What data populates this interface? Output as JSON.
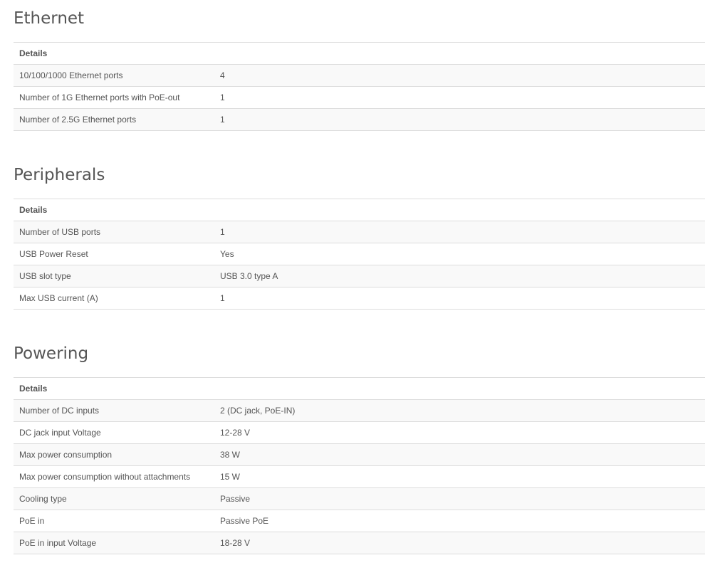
{
  "sections": [
    {
      "title": "Ethernet",
      "header": "Details",
      "rows": [
        {
          "label": "10/100/1000 Ethernet ports",
          "value": "4"
        },
        {
          "label": "Number of 1G Ethernet ports with PoE-out",
          "value": "1"
        },
        {
          "label": "Number of 2.5G Ethernet ports",
          "value": "1"
        }
      ]
    },
    {
      "title": "Peripherals",
      "header": "Details",
      "rows": [
        {
          "label": "Number of USB ports",
          "value": "1"
        },
        {
          "label": "USB Power Reset",
          "value": "Yes"
        },
        {
          "label": "USB slot type",
          "value": "USB 3.0 type A"
        },
        {
          "label": "Max USB current (A)",
          "value": "1"
        }
      ]
    },
    {
      "title": "Powering",
      "header": "Details",
      "rows": [
        {
          "label": "Number of DC inputs",
          "value": "2 (DC jack, PoE-IN)"
        },
        {
          "label": "DC jack input Voltage",
          "value": "12-28 V"
        },
        {
          "label": "Max power consumption",
          "value": "38 W"
        },
        {
          "label": "Max power consumption without attachments",
          "value": "15 W"
        },
        {
          "label": "Cooling type",
          "value": "Passive"
        },
        {
          "label": "PoE in",
          "value": "Passive PoE"
        },
        {
          "label": "PoE in input Voltage",
          "value": "18-28 V"
        }
      ]
    }
  ],
  "colors": {
    "text": "#555555",
    "border": "#dddddd",
    "row_stripe": "#f9f9f9",
    "background": "#ffffff"
  }
}
